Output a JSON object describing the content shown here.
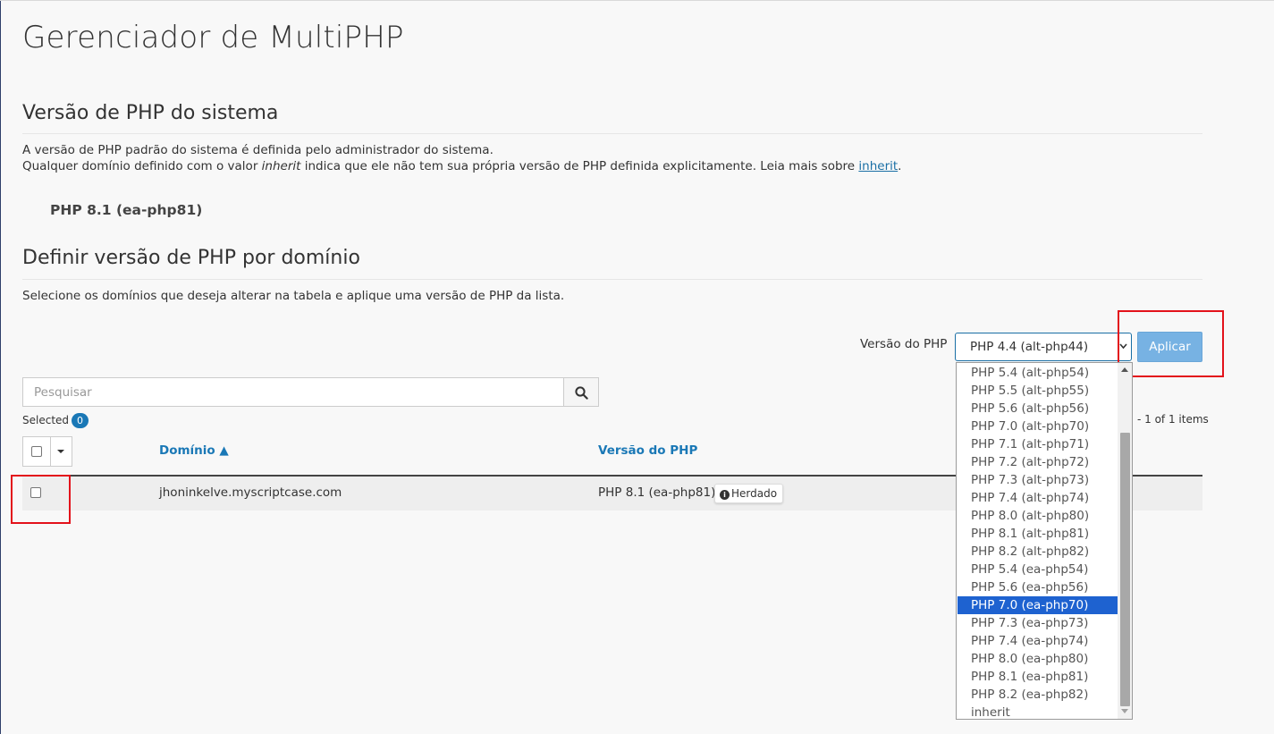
{
  "page": {
    "title": "Gerenciador de MultiPHP"
  },
  "system_section": {
    "title": "Versão de PHP do sistema",
    "desc_line1": "A versão de PHP padrão do sistema é definida pelo administrador do sistema.",
    "desc_line2_prefix": "Qualquer domínio definido com o valor ",
    "desc_line2_em": "inherit",
    "desc_line2_middle": " indica que ele não tem sua própria versão de PHP definida explicitamente. Leia mais sobre ",
    "desc_line2_link": "inherit",
    "desc_line2_suffix": ".",
    "current_version": "PHP 8.1 (ea-php81)"
  },
  "domain_section": {
    "title": "Definir versão de PHP por domínio",
    "desc": "Selecione os domínios que deseja alterar na tabela e aplique uma versão de PHP da lista."
  },
  "toolbar": {
    "php_label": "Versão do PHP",
    "selected_value": "PHP 4.4 (alt-php44)",
    "apply_label": "Aplicar"
  },
  "dropdown": {
    "options": [
      "PHP 5.4 (alt-php54)",
      "PHP 5.5 (alt-php55)",
      "PHP 5.6 (alt-php56)",
      "PHP 7.0 (alt-php70)",
      "PHP 7.1 (alt-php71)",
      "PHP 7.2 (alt-php72)",
      "PHP 7.3 (alt-php73)",
      "PHP 7.4 (alt-php74)",
      "PHP 8.0 (alt-php80)",
      "PHP 8.1 (alt-php81)",
      "PHP 8.2 (alt-php82)",
      "PHP 5.4 (ea-php54)",
      "PHP 5.6 (ea-php56)",
      "PHP 7.0 (ea-php70)",
      "PHP 7.3 (ea-php73)",
      "PHP 7.4 (ea-php74)",
      "PHP 8.0 (ea-php80)",
      "PHP 8.1 (ea-php81)",
      "PHP 8.2 (ea-php82)",
      "inherit"
    ],
    "highlighted_index": 13
  },
  "search": {
    "placeholder": "Pesquisar"
  },
  "selection": {
    "label": "Selected",
    "count": "0"
  },
  "pagination": {
    "text": "- 1 of 1 items"
  },
  "table": {
    "columns": {
      "domain": "Domínio ▲",
      "php_version": "Versão do PHP"
    },
    "rows": [
      {
        "domain": "jhoninkelve.myscriptcase.com",
        "php_version": "PHP 8.1 (ea-php81)",
        "badge": "Herdado"
      }
    ]
  },
  "colors": {
    "accent": "#1a78b6",
    "apply_button": "#77b2e3",
    "highlight": "#1e62d0",
    "annotation_red": "#e3121b"
  },
  "icons": {
    "search": "search-icon",
    "info": "info-icon",
    "caret": "caret-down-icon",
    "select": "chevron-down-icon"
  }
}
